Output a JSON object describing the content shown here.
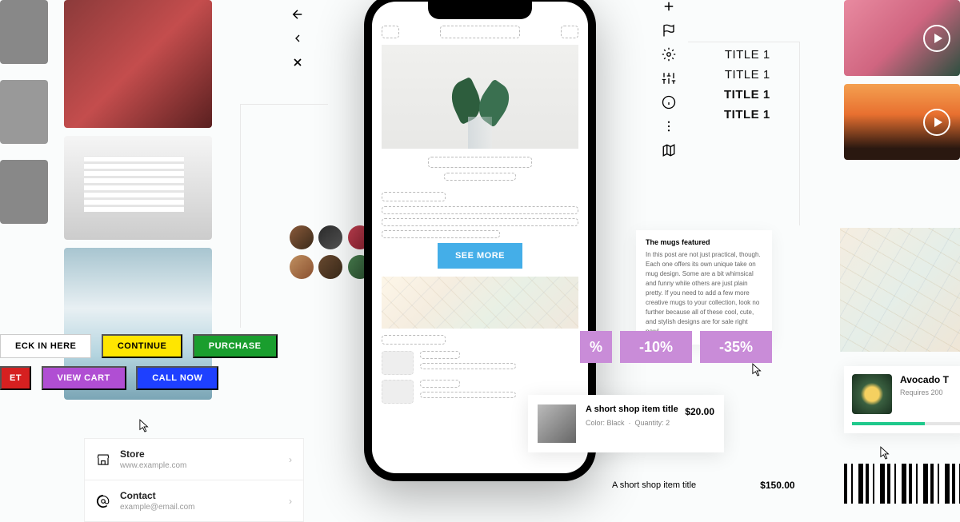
{
  "buttons": {
    "check_in": "ECK IN HERE",
    "continue": "CONTINUE",
    "purchase": "PURCHASE",
    "et": "ET",
    "view_cart": "VIEW CART",
    "call_now": "CALL NOW"
  },
  "contacts": {
    "store": {
      "title": "Store",
      "sub": "www.example.com"
    },
    "contact": {
      "title": "Contact",
      "sub": "example@email.com"
    }
  },
  "phone": {
    "see_more": "SEE MORE"
  },
  "titles": [
    "TITLE 1",
    "TITLE 1",
    "TITLE 1",
    "TITLE 1"
  ],
  "text_card": {
    "heading": "The mugs featured",
    "body": "In this post are not just practical, though. Each one offers its own unique take on mug design. Some are a bit whimsical and funny while others are just plain pretty. If you need to add a few more creative mugs to your collection, look no further because all of these cool, cute, and stylish designs are for sale right now!"
  },
  "discounts": [
    "%",
    "-10%",
    "-35%"
  ],
  "shop1": {
    "title": "A short shop item title",
    "price": "$20.00",
    "meta_color_label": "Color:",
    "meta_color_value": "Black",
    "meta_qty_label": "Quantity:",
    "meta_qty_value": "2"
  },
  "shop2": {
    "title": "A short shop item title",
    "price": "$150.00"
  },
  "avocado": {
    "title": "Avocado T",
    "sub": "Requires 200"
  },
  "icons": {
    "back": "arrow-left",
    "prev": "chevron-left",
    "close": "x",
    "plus": "plus",
    "flag": "flag",
    "gear": "gear",
    "sliders": "sliders",
    "info": "info",
    "more": "more-vertical",
    "map": "map"
  }
}
